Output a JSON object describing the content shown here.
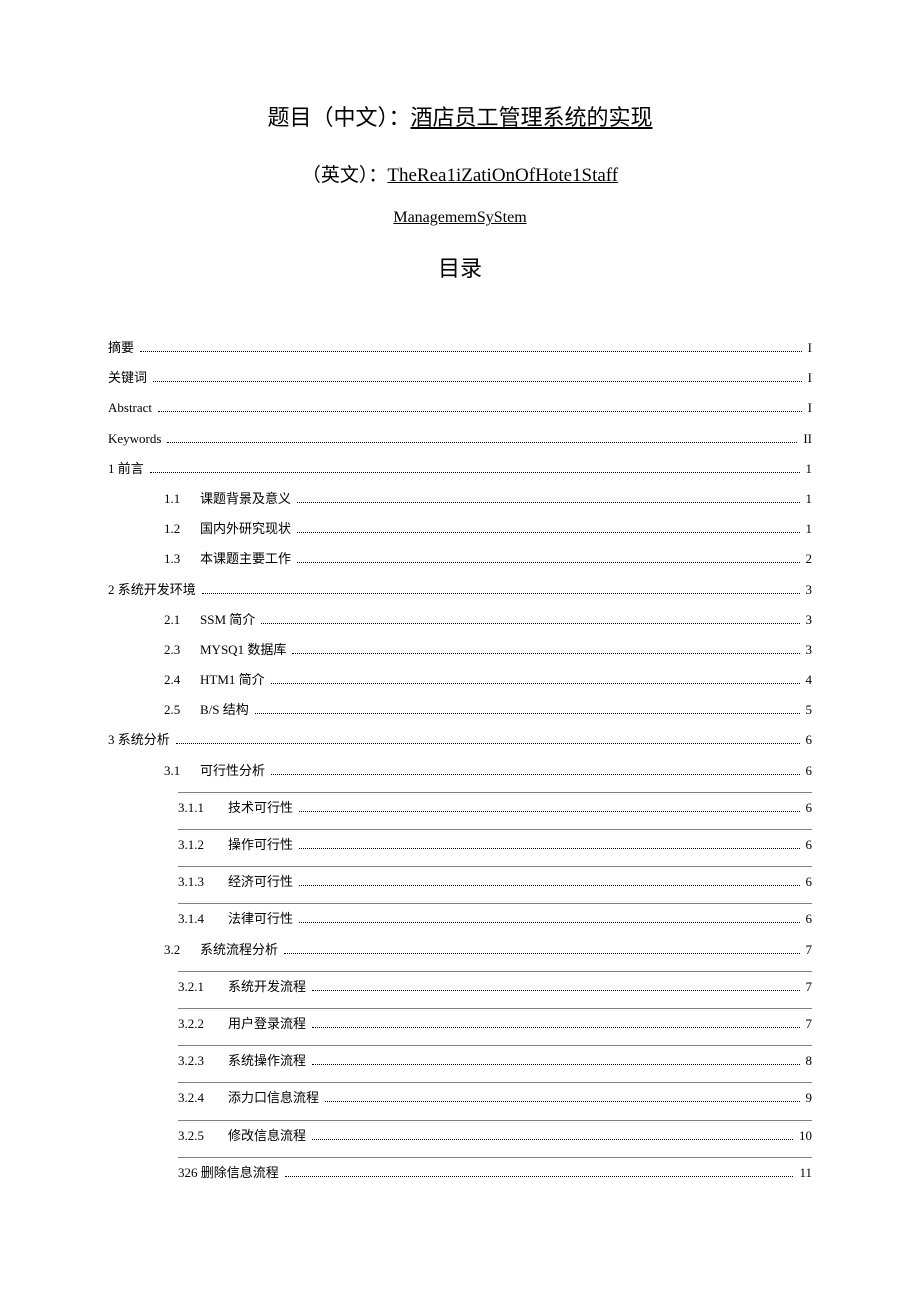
{
  "title": {
    "label_cn": "题目（中文）：",
    "text_cn": "酒店员工管理系统的实现",
    "label_en": "（英文）：",
    "text_en_1": "TheRea1iZatiOnOfHote1Staff",
    "text_en_2": "ManagememSyStem"
  },
  "toc_heading": "目录",
  "toc": [
    {
      "level": 0,
      "num": "",
      "text": "摘要",
      "page": "I"
    },
    {
      "level": 0,
      "num": "",
      "text": "关键词",
      "page": "I"
    },
    {
      "level": 0,
      "num": "",
      "text": "Abstract",
      "page": "I"
    },
    {
      "level": 0,
      "num": "",
      "text": "Keywords",
      "page": "II"
    },
    {
      "level": 0,
      "num": "",
      "text": "1 前言",
      "page": "1"
    },
    {
      "level": 1,
      "num": "1.1",
      "text": "课题背景及意义",
      "page": "1"
    },
    {
      "level": 1,
      "num": "1.2",
      "text": "国内外研究现状",
      "page": "1"
    },
    {
      "level": 1,
      "num": "1.3",
      "text": "本课题主要工作",
      "page": "2"
    },
    {
      "level": 0,
      "num": "",
      "text": "2 系统开发环境",
      "page": "3"
    },
    {
      "level": 1,
      "num": "2.1",
      "text": "SSM 简介",
      "page": "3"
    },
    {
      "level": 1,
      "num": "2.3",
      "text": "MYSQ1 数据库",
      "page": "3"
    },
    {
      "level": 1,
      "num": "2.4",
      "text": "HTM1 简介",
      "page": "4"
    },
    {
      "level": 1,
      "num": "2.5",
      "text": "B/S 结构",
      "page": "5"
    },
    {
      "level": 0,
      "num": "",
      "text": "3 系统分析",
      "page": "6"
    },
    {
      "level": 1,
      "num": "3.1",
      "text": "可行性分析",
      "page": "6"
    },
    {
      "level": 2,
      "num": "3.1.1",
      "text": "技术可行性",
      "page": "6",
      "sep": true
    },
    {
      "level": 2,
      "num": "3.1.2",
      "text": "操作可行性",
      "page": "6",
      "sep": true
    },
    {
      "level": 2,
      "num": "3.1.3",
      "text": "经济可行性",
      "page": "6",
      "sep": true
    },
    {
      "level": 2,
      "num": "3.1.4",
      "text": "法律可行性",
      "page": "6",
      "sep": true
    },
    {
      "level": 1,
      "num": "3.2",
      "text": "系统流程分析",
      "page": "7"
    },
    {
      "level": 2,
      "num": "3.2.1",
      "text": "系统开发流程",
      "page": "7",
      "sep": true
    },
    {
      "level": 2,
      "num": "3.2.2",
      "text": "用户登录流程",
      "page": "7",
      "sep": true
    },
    {
      "level": 2,
      "num": "3.2.3",
      "text": "系统操作流程",
      "page": "8",
      "sep": true
    },
    {
      "level": 2,
      "num": "3.2.4",
      "text": "添力口信息流程",
      "page": "9",
      "sep": true
    },
    {
      "level": 2,
      "num": "3.2.5",
      "text": "修改信息流程",
      "page": "10",
      "sep": true
    },
    {
      "level": 2,
      "num": "",
      "text": "326 删除信息流程",
      "page": "11",
      "sep": true
    }
  ]
}
